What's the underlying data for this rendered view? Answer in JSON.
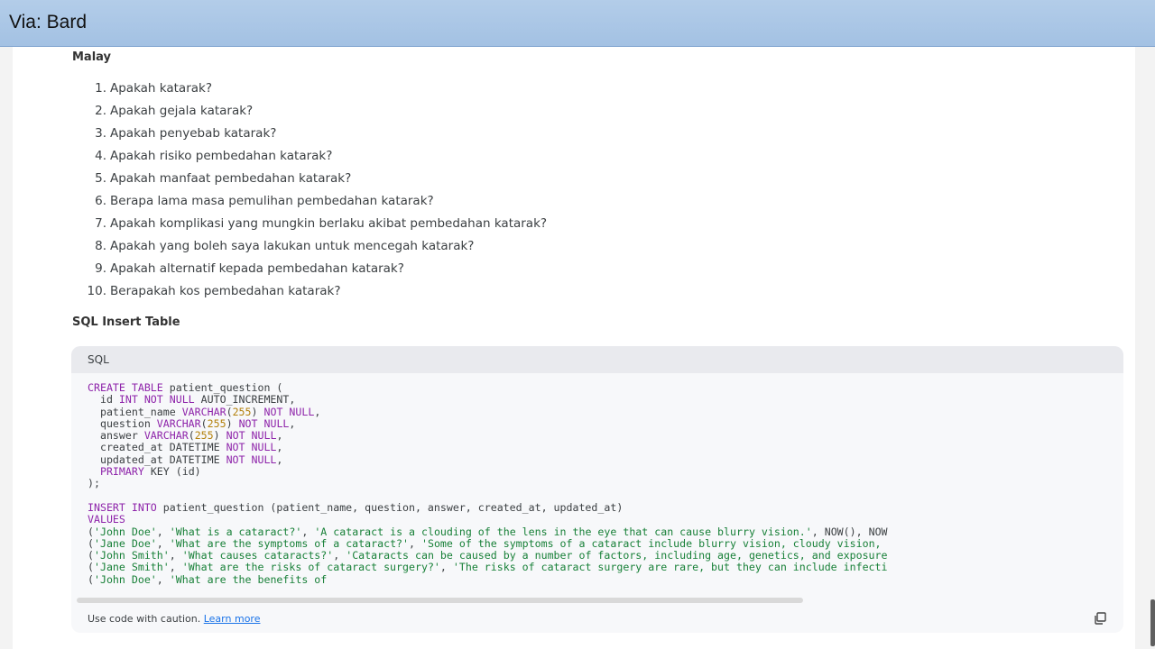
{
  "window": {
    "title": "Via: Bard"
  },
  "content": {
    "malay_heading": "Malay",
    "questions": [
      {
        "num": "1.",
        "text": "Apakah katarak?"
      },
      {
        "num": "2.",
        "text": "Apakah gejala katarak?"
      },
      {
        "num": "3.",
        "text": "Apakah penyebab katarak?"
      },
      {
        "num": "4.",
        "text": "Apakah risiko pembedahan katarak?"
      },
      {
        "num": "5.",
        "text": "Apakah manfaat pembedahan katarak?"
      },
      {
        "num": "6.",
        "text": "Berapa lama masa pemulihan pembedahan katarak?"
      },
      {
        "num": "7.",
        "text": "Apakah komplikasi yang mungkin berlaku akibat pembedahan katarak?"
      },
      {
        "num": "8.",
        "text": "Apakah yang boleh saya lakukan untuk mencegah katarak?"
      },
      {
        "num": "9.",
        "text": "Apakah alternatif kepada pembedahan katarak?"
      },
      {
        "num": "10.",
        "text": "Berapakah kos pembedahan katarak?"
      }
    ],
    "sql_heading": "SQL Insert Table"
  },
  "code_block": {
    "language": "SQL",
    "lines": [
      [
        [
          "kw",
          "CREATE TABLE"
        ],
        [
          "t",
          " patient_question ("
        ]
      ],
      [
        [
          "t",
          "  id "
        ],
        [
          "kw",
          "INT NOT NULL"
        ],
        [
          "t",
          " AUTO_INCREMENT,"
        ]
      ],
      [
        [
          "t",
          "  patient_name "
        ],
        [
          "kw",
          "VARCHAR"
        ],
        [
          "t",
          "("
        ],
        [
          "n",
          "255"
        ],
        [
          "t",
          ") "
        ],
        [
          "kw",
          "NOT NULL"
        ],
        [
          "t",
          ","
        ]
      ],
      [
        [
          "t",
          "  question "
        ],
        [
          "kw",
          "VARCHAR"
        ],
        [
          "t",
          "("
        ],
        [
          "n",
          "255"
        ],
        [
          "t",
          ") "
        ],
        [
          "kw",
          "NOT NULL"
        ],
        [
          "t",
          ","
        ]
      ],
      [
        [
          "t",
          "  answer "
        ],
        [
          "kw",
          "VARCHAR"
        ],
        [
          "t",
          "("
        ],
        [
          "n",
          "255"
        ],
        [
          "t",
          ") "
        ],
        [
          "kw",
          "NOT NULL"
        ],
        [
          "t",
          ","
        ]
      ],
      [
        [
          "t",
          "  created_at DATETIME "
        ],
        [
          "kw",
          "NOT NULL"
        ],
        [
          "t",
          ","
        ]
      ],
      [
        [
          "t",
          "  updated_at DATETIME "
        ],
        [
          "kw",
          "NOT NULL"
        ],
        [
          "t",
          ","
        ]
      ],
      [
        [
          "t",
          "  "
        ],
        [
          "kw",
          "PRIMARY"
        ],
        [
          "t",
          " KEY (id)"
        ]
      ],
      [
        [
          "t",
          ");"
        ]
      ],
      [
        [
          "t",
          ""
        ]
      ],
      [
        [
          "kw",
          "INSERT INTO"
        ],
        [
          "t",
          " patient_question (patient_name, question, answer, created_at, updated_at)"
        ]
      ],
      [
        [
          "kw",
          "VALUES"
        ]
      ],
      [
        [
          "t",
          "("
        ],
        [
          "s",
          "'John Doe'"
        ],
        [
          "t",
          ", "
        ],
        [
          "s",
          "'What is a cataract?'"
        ],
        [
          "t",
          ", "
        ],
        [
          "s",
          "'A cataract is a clouding of the lens in the eye that can cause blurry vision.'"
        ],
        [
          "t",
          ", NOW(), NOW"
        ]
      ],
      [
        [
          "t",
          "("
        ],
        [
          "s",
          "'Jane Doe'"
        ],
        [
          "t",
          ", "
        ],
        [
          "s",
          "'What are the symptoms of a cataract?'"
        ],
        [
          "t",
          ", "
        ],
        [
          "s",
          "'Some of the symptoms of a cataract include blurry vision, cloudy vision,"
        ]
      ],
      [
        [
          "t",
          "("
        ],
        [
          "s",
          "'John Smith'"
        ],
        [
          "t",
          ", "
        ],
        [
          "s",
          "'What causes cataracts?'"
        ],
        [
          "t",
          ", "
        ],
        [
          "s",
          "'Cataracts can be caused by a number of factors, including age, genetics, and exposure"
        ]
      ],
      [
        [
          "t",
          "("
        ],
        [
          "s",
          "'Jane Smith'"
        ],
        [
          "t",
          ", "
        ],
        [
          "s",
          "'What are the risks of cataract surgery?'"
        ],
        [
          "t",
          ", "
        ],
        [
          "s",
          "'The risks of cataract surgery are rare, but they can include infecti"
        ]
      ],
      [
        [
          "t",
          "("
        ],
        [
          "s",
          "'John Doe'"
        ],
        [
          "t",
          ", "
        ],
        [
          "s",
          "'What are the benefits of"
        ]
      ]
    ],
    "footer_text": "Use code with caution.",
    "learn_more": "Learn more",
    "copy_icon": "copy-icon"
  },
  "scroll": {
    "horizontal_visible_fraction": 0.7
  },
  "colors": {
    "keyword": "#8e24aa",
    "number": "#b3800b",
    "string": "#188038",
    "link": "#1a73e8",
    "titlebar": "#a9c6e6"
  }
}
